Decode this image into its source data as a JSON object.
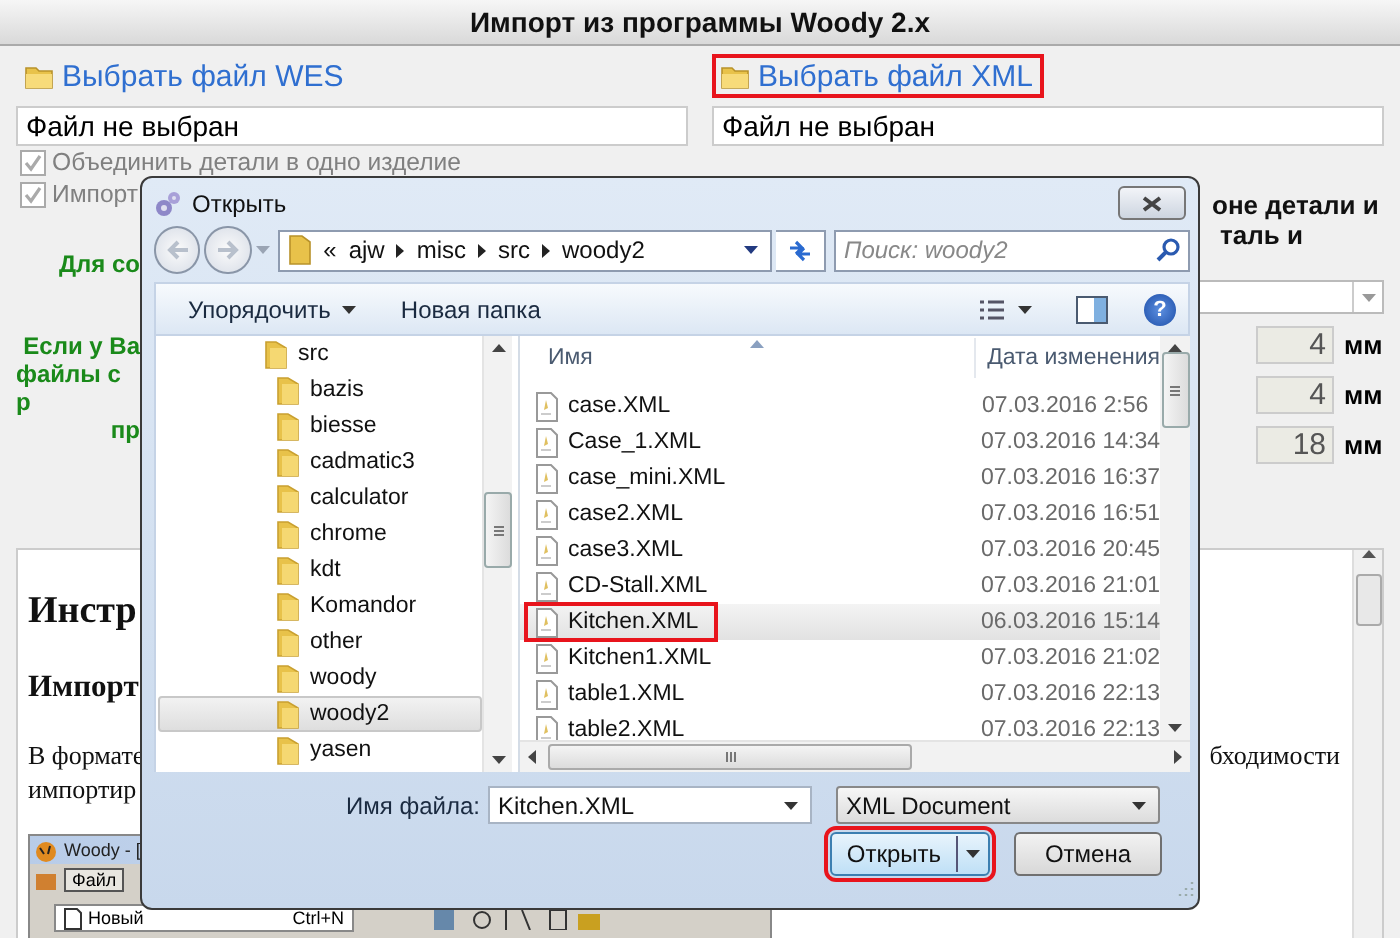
{
  "page": {
    "title": "Импорт из программы Woody 2.x",
    "file_sources": [
      {
        "link": "Выбрать файл WES",
        "path": "Файл не выбран",
        "highlighted": false
      },
      {
        "link": "Выбрать файл XML",
        "path": "Файл не выбран",
        "highlighted": true
      }
    ],
    "options": [
      {
        "label": "Объединить детали в одно изделие",
        "checked": true,
        "disabled": true
      },
      {
        "label": "Импорт",
        "checked": true,
        "disabled": true
      }
    ],
    "note_lines": [
      "Для со",
      "Если у Ва",
      "файлы с р",
      "пр"
    ],
    "heading_lines": [
      "оне детали и",
      "таль и"
    ],
    "measurements": [
      {
        "value": "4",
        "unit": "мм"
      },
      {
        "value": "4",
        "unit": "мм"
      },
      {
        "value": "18",
        "unit": "мм"
      }
    ],
    "document": {
      "heading": "Инстр",
      "subheading": "Импорт",
      "lines": [
        "В формате",
        "импортир"
      ],
      "line_end": "бходимости",
      "screenshot": {
        "title": "Woody - [",
        "menu": "Файл",
        "item": "Новый",
        "shortcut": "Ctrl+N"
      }
    }
  },
  "dialog": {
    "title": "Открыть",
    "breadcrumb": {
      "overflow": "«",
      "parts": [
        "ajw",
        "misc",
        "src",
        "woody2"
      ]
    },
    "search": {
      "placeholder": "Поиск: woody2"
    },
    "toolbar": {
      "organize": "Упорядочить",
      "new_folder": "Новая папка",
      "help": "?"
    },
    "tree": [
      {
        "name": "src",
        "selected": false,
        "children": [
          {
            "name": "bazis",
            "selected": false
          },
          {
            "name": "biesse",
            "selected": false
          },
          {
            "name": "cadmatic3",
            "selected": false
          },
          {
            "name": "calculator",
            "selected": false
          },
          {
            "name": "chrome",
            "selected": false
          },
          {
            "name": "kdt",
            "selected": false
          },
          {
            "name": "Komandor",
            "selected": false
          },
          {
            "name": "other",
            "selected": false
          },
          {
            "name": "woody",
            "selected": false
          },
          {
            "name": "woody2",
            "selected": true
          },
          {
            "name": "yasen",
            "selected": false
          }
        ]
      }
    ],
    "columns": [
      "Имя",
      "Дата изменения"
    ],
    "files": [
      {
        "name": "case.XML",
        "date": "07.03.2016 2:56",
        "selected": false,
        "highlighted": false
      },
      {
        "name": "Case_1.XML",
        "date": "07.03.2016 14:34",
        "selected": false,
        "highlighted": false
      },
      {
        "name": "case_mini.XML",
        "date": "07.03.2016 16:37",
        "selected": false,
        "highlighted": false
      },
      {
        "name": "case2.XML",
        "date": "07.03.2016 16:51",
        "selected": false,
        "highlighted": false
      },
      {
        "name": "case3.XML",
        "date": "07.03.2016 20:45",
        "selected": false,
        "highlighted": false
      },
      {
        "name": "CD-Stall.XML",
        "date": "07.03.2016 21:01",
        "selected": false,
        "highlighted": false
      },
      {
        "name": "Kitchen.XML",
        "date": "06.03.2016 15:14",
        "selected": true,
        "highlighted": true
      },
      {
        "name": "Kitchen1.XML",
        "date": "07.03.2016 21:02",
        "selected": false,
        "highlighted": false
      },
      {
        "name": "table1.XML",
        "date": "07.03.2016 22:13",
        "selected": false,
        "highlighted": false
      },
      {
        "name": "table2.XML",
        "date": "07.03.2016 22:13",
        "selected": false,
        "highlighted": false
      }
    ],
    "filename_label": "Имя файла:",
    "filename": "Kitchen.XML",
    "filetype": "XML Document",
    "buttons": [
      {
        "label": "Открыть",
        "kind": "split",
        "highlighted": true
      },
      {
        "label": "Отмена",
        "kind": "plain",
        "highlighted": false
      }
    ]
  }
}
